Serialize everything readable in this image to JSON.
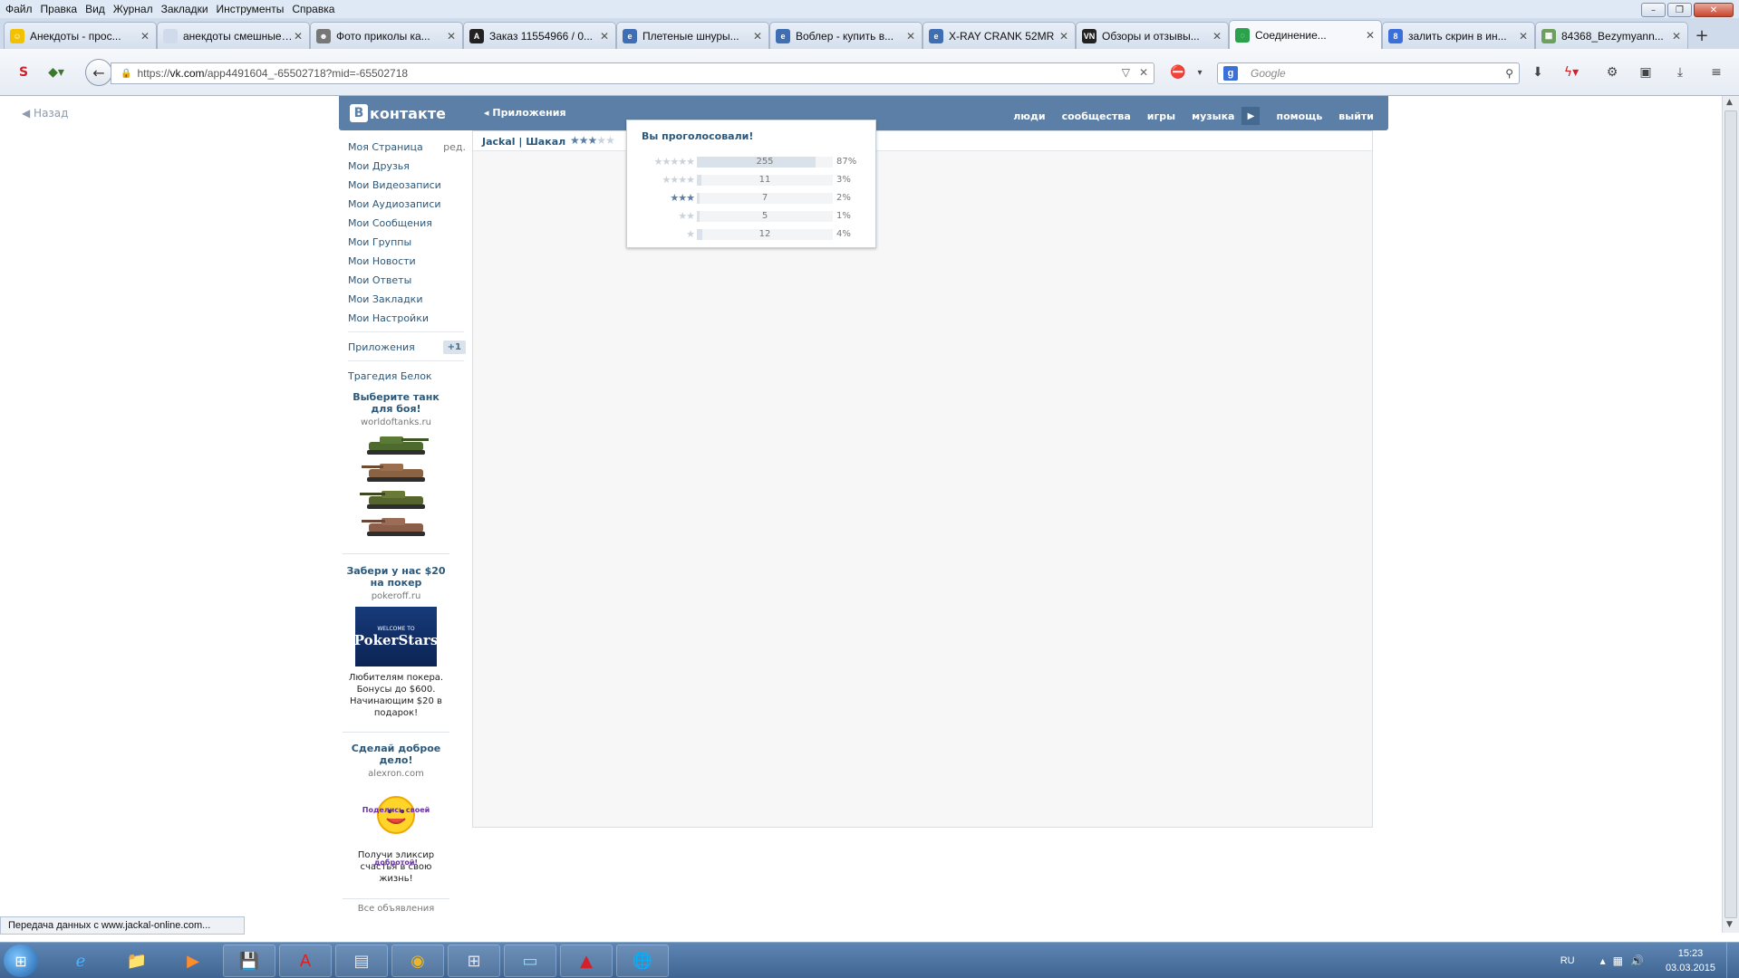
{
  "browser": {
    "menu": [
      "Файл",
      "Правка",
      "Вид",
      "Журнал",
      "Закладки",
      "Инструменты",
      "Справка"
    ],
    "tabs": [
      {
        "title": "Анекдоты - прос...",
        "icon": "smiley-icon",
        "color": "#f2c200"
      },
      {
        "title": "анекдоты смешные п...",
        "icon": "blank-icon",
        "color": "#cfdbeb"
      },
      {
        "title": "Фото приколы ка...",
        "icon": "people-icon",
        "color": "#777777"
      },
      {
        "title": "Заказ 11554966 / 0...",
        "icon": "a-icon",
        "color": "#222222"
      },
      {
        "title": "Плетеные шнуры...",
        "icon": "ie-icon",
        "color": "#3f6fb2"
      },
      {
        "title": "Воблер - купить в...",
        "icon": "ie-icon",
        "color": "#3f6fb2"
      },
      {
        "title": "X-RAY CRANK 52MR",
        "icon": "ie-icon",
        "color": "#3f6fb2"
      },
      {
        "title": "Обзоры и отзывы...",
        "icon": "vn-icon",
        "color": "#222222"
      },
      {
        "title": "Соединение...",
        "icon": "loading-icon",
        "color": "#2aa14a",
        "active": true
      },
      {
        "title": "залить скрин в ин...",
        "icon": "g-icon",
        "color": "#3b6fd9"
      },
      {
        "title": "84368_Bezymyann...",
        "icon": "image-icon",
        "color": "#6d9f5d"
      }
    ],
    "url": {
      "prefix": "https://",
      "host": "vk.com",
      "path": "/app4491604_-65502718?mid=-65502718"
    },
    "search_placeholder": "Google",
    "status_text": "Передача данных с www.jackal-online.com..."
  },
  "page": {
    "back_label": "Назад",
    "logo_text": "контакте",
    "logo_letter": "В",
    "apps_link": "Приложения",
    "top_nav": [
      "люди",
      "сообщества",
      "игры",
      "музыка",
      "помощь",
      "выйти"
    ],
    "left_nav": [
      {
        "label": "Моя Страница",
        "extra": "ред."
      },
      {
        "label": "Мои Друзья"
      },
      {
        "label": "Мои Видеозаписи"
      },
      {
        "label": "Мои Аудиозаписи"
      },
      {
        "label": "Мои Сообщения"
      },
      {
        "label": "Мои Группы"
      },
      {
        "label": "Мои Новости"
      },
      {
        "label": "Мои Ответы"
      },
      {
        "label": "Мои Закладки"
      },
      {
        "label": "Мои Настройки"
      }
    ],
    "apps_item": {
      "label": "Приложения",
      "badge": "+1"
    },
    "extra_item": "Трагедия Белок",
    "ads": [
      {
        "title": "Выберите танк для боя!",
        "domain": "worldoftanks.ru",
        "text": ""
      },
      {
        "title": "Забери у нас $20 на покер",
        "domain": "pokeroff.ru",
        "text": "Любителям покера. Бонусы до $600. Начинающим $20 в подарок!",
        "image_top": "WELCOME TO",
        "image_main": "PokerStars"
      },
      {
        "title": "Сделай доброе дело!",
        "domain": "alexron.com",
        "text": "Получи эликсир счастья в свою жизнь!",
        "image_text": "Поделись своей добротой!"
      }
    ],
    "all_ads": "Все объявления",
    "app": {
      "title": "Jackal | Шакал",
      "rating_stars": 3,
      "popup_title": "Вы проголосовали!",
      "votes": [
        {
          "stars": 5,
          "count": "255",
          "percent": "87%",
          "fraction": 0.87
        },
        {
          "stars": 4,
          "count": "11",
          "percent": "3%",
          "fraction": 0.03
        },
        {
          "stars": 3,
          "count": "7",
          "percent": "2%",
          "fraction": 0.02,
          "selected": true
        },
        {
          "stars": 2,
          "count": "5",
          "percent": "1%",
          "fraction": 0.01
        },
        {
          "stars": 1,
          "count": "12",
          "percent": "4%",
          "fraction": 0.04
        }
      ]
    }
  },
  "taskbar": {
    "lang": "RU",
    "time": "15:23",
    "date": "03.03.2015",
    "apps": [
      "ie-icon",
      "explorer-icon",
      "media-player-icon",
      "save-icon",
      "acrobat-icon",
      "calculator-icon",
      "chrome-icon",
      "network-icon",
      "notepad-icon",
      "autocad-icon",
      "globe-icon"
    ]
  },
  "colors": {
    "vk_blue": "#5b7fa6",
    "link": "#2b587a",
    "star_on": "#5b7fa6",
    "star_off": "#c9d3de"
  }
}
